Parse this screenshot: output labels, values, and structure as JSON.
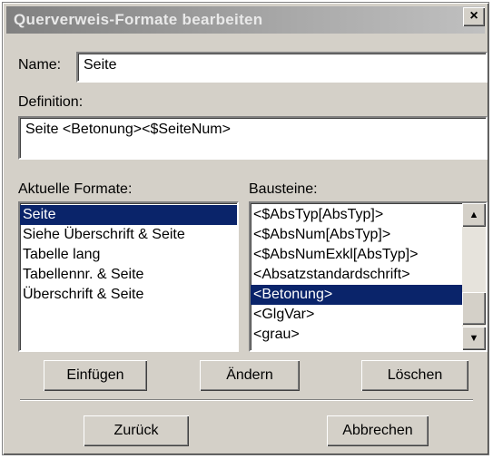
{
  "dialog": {
    "title": "Querverweis-Formate bearbeiten",
    "close_glyph": "×"
  },
  "name_field": {
    "label": "Name:",
    "value": "Seite"
  },
  "definition": {
    "label": "Definition:",
    "value": "Seite <Betonung><$SeiteNum>"
  },
  "formats": {
    "label": "Aktuelle Formate:",
    "items": [
      "Seite",
      "Siehe Überschrift & Seite",
      "Tabelle lang",
      "Tabellennr. & Seite",
      "Überschrift & Seite"
    ],
    "selected_index": 0
  },
  "bausteine": {
    "label": "Bausteine:",
    "items": [
      "<$AbsTyp[AbsTyp]>",
      "<$AbsNum[AbsTyp]>",
      "<$AbsNumExkl[AbsTyp]>",
      "<Absatzstandardschrift>",
      "<Betonung>",
      "<GlgVar>",
      "<grau>"
    ],
    "selected_index": 4,
    "scroll_up_icon": "arrow-up-icon",
    "scroll_down_icon": "arrow-down-icon"
  },
  "buttons": {
    "insert": "Einfügen",
    "change": "Ändern",
    "delete": "Löschen",
    "back": "Zurück",
    "cancel": "Abbrechen"
  },
  "colors": {
    "selection": "#0a246a",
    "face": "#d4d0c8",
    "title_gradient_start": "#808080"
  }
}
